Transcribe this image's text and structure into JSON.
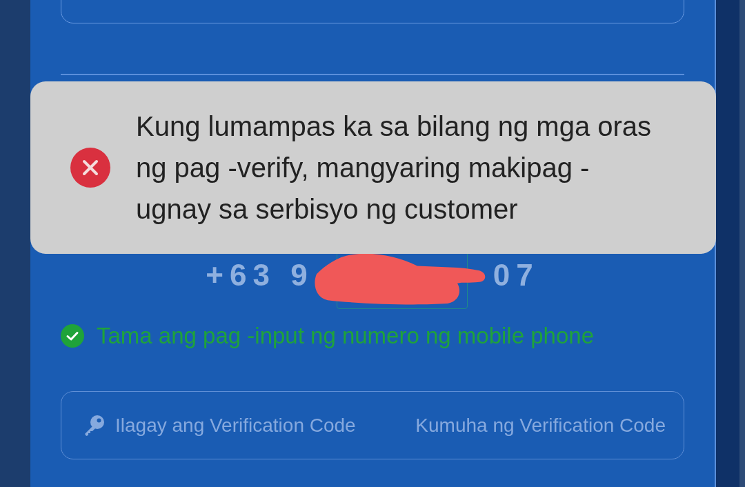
{
  "toast": {
    "kind": "error",
    "message": "Kung lumampas ka sa bilang ng mga oras ng pag -verify, mangyaring makipag -ugnay sa serbisyo ng customer"
  },
  "phone_number": {
    "visible_start": "+63 9",
    "visible_end": "07",
    "redacted": true
  },
  "validation": {
    "valid": true,
    "message": "Tama ang pag -input ng numero ng mobile phone"
  },
  "code_field": {
    "placeholder": "Ilagay ang Verification Code",
    "action_button": "Kumuha ng Verification Code"
  }
}
